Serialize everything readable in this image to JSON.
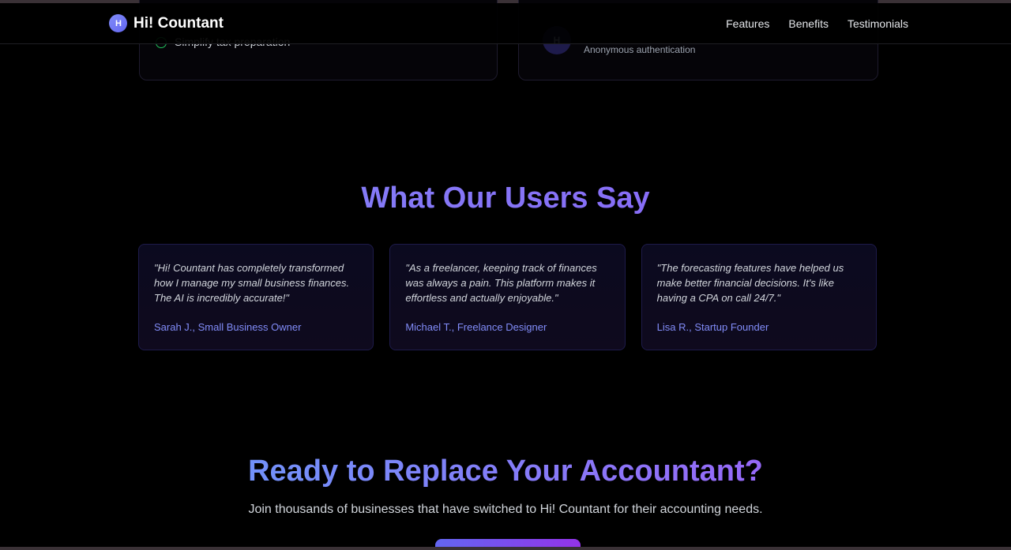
{
  "header": {
    "logo_mark": "H",
    "logo_text": "Hi! Countant",
    "nav": [
      "Features",
      "Benefits",
      "Testimonials"
    ]
  },
  "peek": {
    "left_text": "Simplify tax preparation",
    "right_avatar": "H",
    "right_text": "Anonymous authentication"
  },
  "testimonials": {
    "title": "What Our Users Say",
    "items": [
      {
        "quote": "\"Hi! Countant has completely transformed how I manage my small business finances. The AI is incredibly accurate!\"",
        "author": "Sarah J., Small Business Owner"
      },
      {
        "quote": "\"As a freelancer, keeping track of finances was always a pain. This platform makes it effortless and actually enjoyable.\"",
        "author": "Michael T., Freelance Designer"
      },
      {
        "quote": "\"The forecasting features have helped us make better financial decisions. It's like having a CPA on call 24/7.\"",
        "author": "Lisa R., Startup Founder"
      }
    ]
  },
  "cta": {
    "title": "Ready to Replace Your Accountant?",
    "subtitle": "Join thousands of businesses that have switched to Hi! Countant for their accounting needs."
  },
  "colors": {
    "accent": "#818cf8",
    "gradient_start": "#60a5fa",
    "gradient_end": "#a855f7",
    "background": "#000000"
  }
}
